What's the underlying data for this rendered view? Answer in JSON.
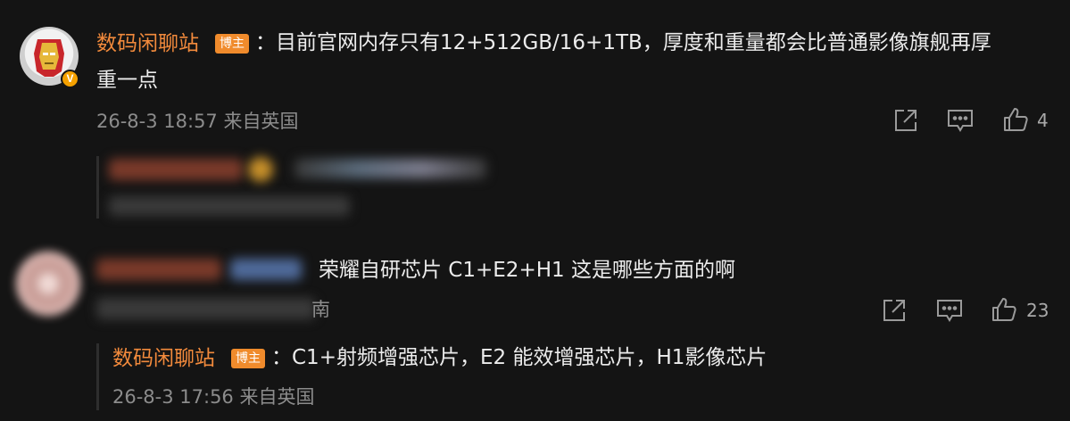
{
  "comment1": {
    "user_name": "数码闲聊站",
    "role_badge": "博主",
    "verified_badge": "V",
    "text_line1": "：目前官网内存只有12+512GB/16+1TB，厚度和重量都会比普通影像旗舰再厚",
    "text_line2": "重一点",
    "meta": "26-8-3 18:57 来自英国",
    "like_count": "4"
  },
  "comment2": {
    "text": "荣耀自研芯片 C1+E2+H1 这是哪些方面的啊",
    "meta_tail": "南",
    "like_count": "23"
  },
  "reply": {
    "user_name": "数码闲聊站",
    "role_badge": "博主",
    "text": "：C1+射频增强芯片，E2 能效增强芯片，H1影像芯片",
    "meta": "26-8-3 17:56 来自英国"
  },
  "colors": {
    "background": "#141414",
    "name_orange": "#f28a3c",
    "badge_orange": "#f08b2c",
    "verified_yellow": "#f5a100",
    "meta_gray": "#8c8c8c"
  },
  "icons": [
    "share-icon",
    "comment-icon",
    "thumbs-up-icon"
  ]
}
